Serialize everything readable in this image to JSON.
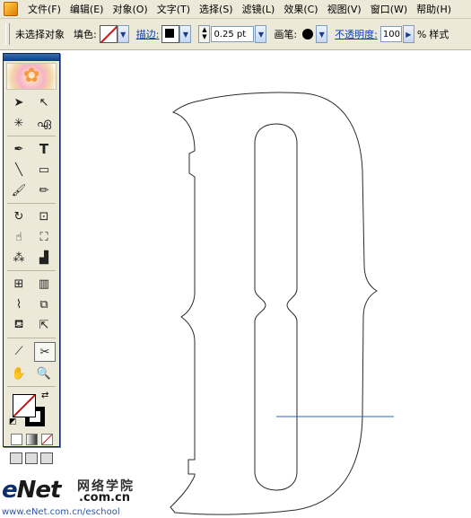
{
  "menu": {
    "items": [
      "文件(F)",
      "编辑(E)",
      "对象(O)",
      "文字(T)",
      "选择(S)",
      "滤镜(L)",
      "效果(C)",
      "视图(V)",
      "窗口(W)",
      "帮助(H)"
    ]
  },
  "control_bar": {
    "selection_status": "未选择对象",
    "fill_label": "填色:",
    "stroke_label": "描边:",
    "stroke_weight": "0.25 pt",
    "brush_label": "画笔:",
    "opacity_label": "不透明度:",
    "opacity_value": "100",
    "opacity_unit": "%",
    "style_label": "样式"
  },
  "tools": {
    "icons": [
      "selection-tool",
      "direct-selection-tool",
      "magic-wand-tool",
      "lasso-tool",
      "pen-tool",
      "type-tool",
      "line-segment-tool",
      "rectangle-tool",
      "paintbrush-tool",
      "pencil-tool",
      "rotate-tool",
      "scale-tool",
      "warp-tool",
      "free-transform-tool",
      "symbol-sprayer-tool",
      "column-graph-tool",
      "mesh-tool",
      "gradient-tool",
      "eyedropper-tool",
      "blend-tool",
      "live-paint-bucket-tool",
      "live-paint-selection-tool",
      "slice-tool",
      "scissors-tool",
      "hand-tool",
      "zoom-tool"
    ]
  },
  "watermark": {
    "logo": "eNet",
    "cn_name": "网络学院",
    "domain": ".com.cn",
    "url": "www.eNet.com.cn/eschool"
  },
  "colors": {
    "ui_bg": "#ece9d8",
    "guide_line": "#2f5fc4",
    "outline": "#2a2a2a"
  }
}
